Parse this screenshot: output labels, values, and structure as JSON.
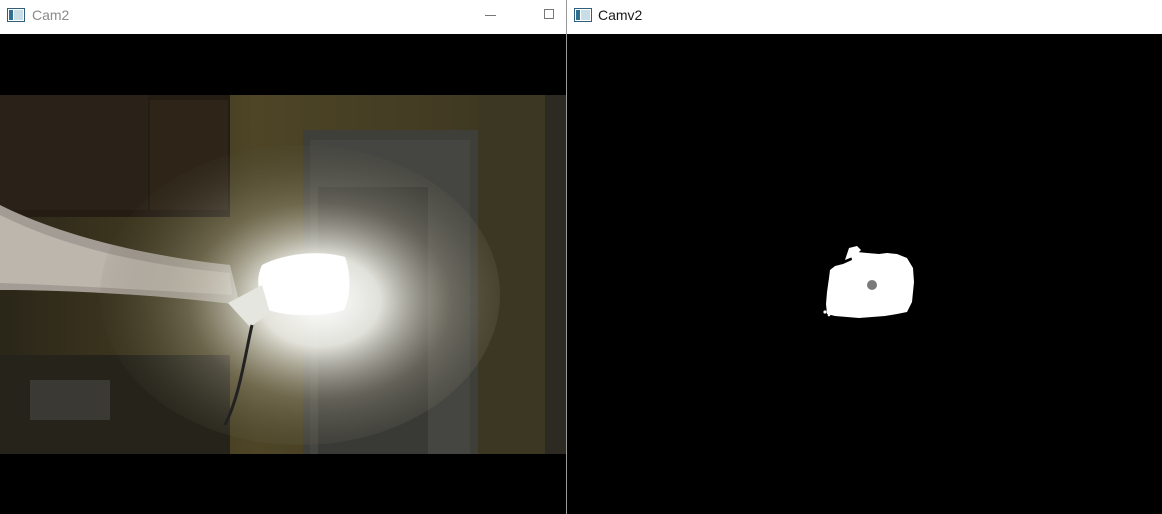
{
  "windows": [
    {
      "title": "Cam2",
      "active": false
    },
    {
      "title": "Camv2",
      "active": true
    }
  ],
  "colors": {
    "titlebar": "#ffffff",
    "inactive_title": "#8a8a8a",
    "active_title": "#1a1a1a",
    "mask_fill": "#ffffff",
    "centroid": "#7a7a7a"
  },
  "icons": {
    "app": "opencv-window-icon",
    "minimize": "minimize-icon",
    "maximize": "maximize-icon"
  }
}
